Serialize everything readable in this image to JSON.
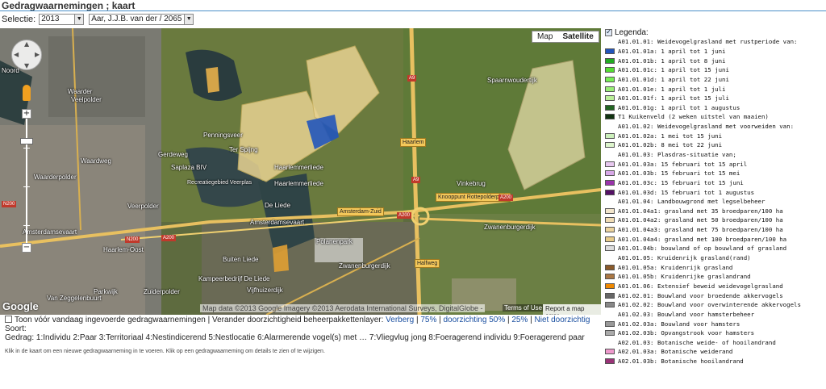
{
  "page": {
    "title": "Gedragwaarnemingen ; kaart"
  },
  "filters": {
    "selectie_label": "Selectie:",
    "year": "2013",
    "observer": "Aar, J.J.B. van der / 2065 A"
  },
  "map": {
    "type_buttons": [
      "Map",
      "Satellite"
    ],
    "active_type": "Satellite",
    "labels": {
      "noord": "Noord",
      "waarder": "Waarder",
      "veelpolder": "Veelpolder",
      "penningsveer": "Penningsveer",
      "gerdeweg": "Gerdeweg",
      "ter_spiing": "Ter Spijng",
      "sasplaza": "Saplaza BIV",
      "recreatiegebied": "Recreatiegebied Veerplas",
      "waarderpolder": "Waarderpolder",
      "waardweg": "Waardweg",
      "veerpolder": "Veerpolder",
      "haarlemmerliede": "Haarlemmerliede",
      "haarlemmerliede2": "Haarlemmerliede",
      "haarlem_oost": "Haarlem-Oost",
      "amsterdamsevaart": "Amsterdamsevaart",
      "amsterdamsevaart2": "Amsterdamsevaart",
      "de_liede": "De Liede",
      "polanenpark": "Polanenpark",
      "buiten_liede": "Buiten Liede",
      "kampeerbedrijf": "Kampeerbedrijf De Liede",
      "parkwijk": "Parkwijk",
      "zuiderpolder": "Zuiderpolder",
      "van_zeggelenbuurt": "Van Zeggelenbuurt",
      "vijfhuizerdijk": "Vijfhuizerdijk",
      "zwanenburgerdijk": "Zwanenburgerdijk",
      "zwanenburgerdijk2": "Zwanenburgerdijk",
      "vinkebrug": "Vinkebrug",
      "spaarnwoudertijk": "Spaarnwoudertijk",
      "haarlem": "Haarlem",
      "amsterdam_zuid": "Amsterdam-Zuid",
      "knooppunt": "Knooppunt Rottepolderplein",
      "halfweg": "Halfweg"
    },
    "shields": {
      "n200_a": "N200",
      "n200_b": "N200",
      "a200_a": "A200",
      "a200_b": "A200",
      "a200_c": "A200",
      "a9_a": "A9",
      "a9_b": "A9"
    },
    "google_logo": "Google",
    "attribution": "Map data ©2013 Google Imagery ©2013 Aerodata International Surveys, DigitalGlobe -",
    "terms": "Terms of Use",
    "report": "Report a map error"
  },
  "below_map": {
    "toon_label": "Toon vóór vandaag ingevoerde gedragwaarnemingen",
    "verander_label": " | Verander doorzichtigheid beheerpakkettenlayer: ",
    "opacity_options": [
      "Verberg",
      "75%",
      "doorzichting 50%",
      "25%",
      "Niet doorzichtig"
    ],
    "soort_label": "Soort:",
    "gedrag_label": "Gedrag:",
    "gedrag_items": "1:Individu 2:Paar 3:Territoriaal 4:Nestindicerend 5:Nestlocatie 6:Alarmerende vogel(s) met … 7:Vliegvlug jong 8:Foeragerend individu 9:Foeragerend paar",
    "hint": "Klik in de kaart om een nieuwe gedragwaarneming in te voeren. Klik op een gedragwaarneming om details te zien of te wijzigen."
  },
  "legend": {
    "title": "Legenda:",
    "items": [
      {
        "label": "A01.01.01: Weidevogelgrasland met rustperiode van:",
        "color": ""
      },
      {
        "label": "A01.01.01a: 1 april tot 1 juni",
        "color": "#2255bb"
      },
      {
        "label": "A01.01.01b: 1 april tot 8 juni",
        "color": "#22aa22"
      },
      {
        "label": "A01.01.01c: 1 april tot 15 juni",
        "color": "#55dd33"
      },
      {
        "label": "A01.01.01d: 1 april tot 22 juni",
        "color": "#77ee55"
      },
      {
        "label": "A01.01.01e: 1 april tot 1 juli",
        "color": "#99ee77"
      },
      {
        "label": "A01.01.01f: 1 april tot 15 juli",
        "color": "#bbf099"
      },
      {
        "label": "A01.01.01g: 1 april tot 1 augustus",
        "color": "#226622"
      },
      {
        "label": "T1 Kuikenveld (2 weken uitstel van maaien)",
        "color": "#113311"
      },
      {
        "label": "A01.01.02: Weidevogelgrasland met voorweiden van:",
        "color": ""
      },
      {
        "label": "A01.01.02a: 1 mei tot 15 juni",
        "color": "#ccf0bb"
      },
      {
        "label": "A01.01.02b: 8 mei tot 22 juni",
        "color": "#ddf5cc"
      },
      {
        "label": "A01.01.03: Plasdras-situatie van;",
        "color": ""
      },
      {
        "label": "A01.01.03a: 15 februari tot 15 april",
        "color": "#e8c8f0"
      },
      {
        "label": "A01.01.03b: 15 februari tot 15 mei",
        "color": "#d8a8e8"
      },
      {
        "label": "A01.01.03c: 15 februari tot 15 juni",
        "color": "#9933aa"
      },
      {
        "label": "A01.01.03d: 15 februari tot 1 augustus",
        "color": "#551166"
      },
      {
        "label": "A01.01.04: Landbouwgrond met legselbeheer",
        "color": ""
      },
      {
        "label": "A01.01.04a1: grasland met 35 broedparen/100 ha",
        "color": "#f3e6cc"
      },
      {
        "label": "A01.01.04a2: grasland met 50 broedparen/100 ha",
        "color": "#f0dcb4"
      },
      {
        "label": "A01.01.04a3: grasland met 75 broedparen/100 ha",
        "color": "#ecd49e"
      },
      {
        "label": "A01.01.04a4: grasland met 100 broedparen/100 ha",
        "color": "#e8cc8a"
      },
      {
        "label": "A01.01.04b: bouwland of op bouwland of grasland",
        "color": "#dddddd"
      },
      {
        "label": "A01.01.05: Kruidenrijk grasland(rand)",
        "color": ""
      },
      {
        "label": "A01.01.05a: Kruidenrijk grasland",
        "color": "#8a5a2a"
      },
      {
        "label": "A01.01.05b: Kruidenrijke graslandrand",
        "color": "#aa7744"
      },
      {
        "label": "A01.01.06: Extensief beweid weidevogelgrasland",
        "color": "#ee8800"
      },
      {
        "label": "A01.02.01: Bouwland voor broedende akkervogels",
        "color": "#666666"
      },
      {
        "label": "A01.02.02: Bouwland voor overwinterende akkervogels",
        "color": "#888888"
      },
      {
        "label": "A01.02.03: Bouwland voor hamsterbeheer",
        "color": ""
      },
      {
        "label": "A01.02.03a: Bouwland voor hamsters",
        "color": "#999999"
      },
      {
        "label": "A01.02.03b: Opvangstrook voor hamsters",
        "color": "#aaaaaa"
      },
      {
        "label": "A02.01.03: Botanische weide- of hooilandrand",
        "color": ""
      },
      {
        "label": "A02.01.03a: Botanische weiderand",
        "color": "#ee99cc"
      },
      {
        "label": "A02.01.03b: Botanische hooilandrand",
        "color": "#993377"
      }
    ]
  }
}
